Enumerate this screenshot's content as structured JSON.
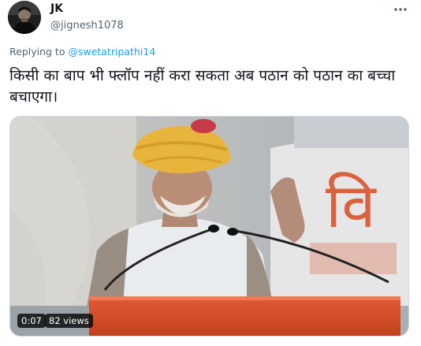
{
  "tweet": {
    "author": {
      "display_name": "JK",
      "handle": "@jignesh1078"
    },
    "replying_prefix": "Replying to",
    "replying_to": "@swetatripathi14",
    "text": "किसी का बाप भी फ्लॉप नहीं करा सकता अब पठान को पठान का बच्चा बचाएगा।",
    "media": {
      "type": "video",
      "duration": "0:07",
      "views": "82 views",
      "banner_text": "वि"
    }
  },
  "icons": {
    "more": "more-options-icon",
    "avatar": "avatar-image"
  },
  "colors": {
    "link": "#1d9bf0",
    "secondary_text": "#536471",
    "turban": "#e8b53c",
    "banner_text": "#d9542c"
  }
}
